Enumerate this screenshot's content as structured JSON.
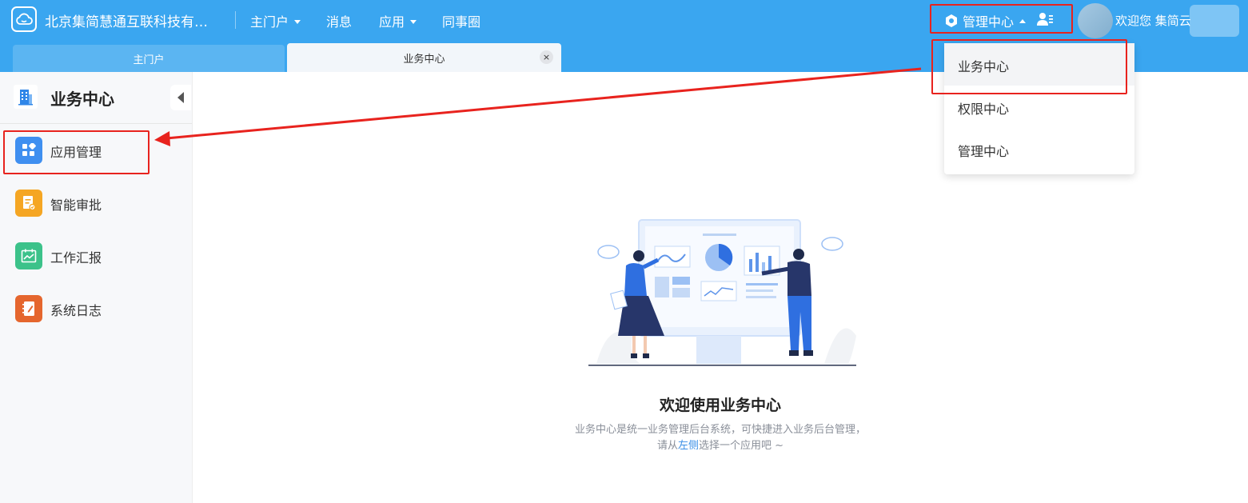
{
  "header": {
    "company_name": "北京集简慧通互联科技有…",
    "nav": [
      {
        "label": "主门户",
        "has_caret": true
      },
      {
        "label": "消息",
        "has_caret": false
      },
      {
        "label": "应用",
        "has_caret": true
      },
      {
        "label": "同事圈",
        "has_caret": false
      }
    ],
    "center_switch_label": "管理中心",
    "welcome_text": "欢迎您  集简云"
  },
  "tabs": {
    "home_label": "主门户",
    "active_label": "业务中心",
    "close_glyph": "×"
  },
  "sidebar": {
    "title": "业务中心",
    "items": [
      {
        "label": "应用管理",
        "icon": "app-grid-icon",
        "color": "#3f8ff0"
      },
      {
        "label": "智能审批",
        "icon": "approval-doc-icon",
        "color": "#f5a623"
      },
      {
        "label": "工作汇报",
        "icon": "report-chart-icon",
        "color": "#3cc28a"
      },
      {
        "label": "系统日志",
        "icon": "log-book-icon",
        "color": "#e5662e"
      }
    ]
  },
  "dropdown": {
    "items": [
      "业务中心",
      "权限中心",
      "管理中心"
    ],
    "selected_index": 0
  },
  "main": {
    "welcome_title": "欢迎使用业务中心",
    "desc_line1": "业务中心是统一业务管理后台系统，可快捷进入业务后台管理，",
    "desc_line2_before": "请从",
    "desc_line2_link": "左侧",
    "desc_line2_after": "选择一个应用吧 ~"
  },
  "colors": {
    "header_bg": "#3aa6f0",
    "annotation_red": "#e8231e",
    "link_blue": "#3a8ee6"
  }
}
